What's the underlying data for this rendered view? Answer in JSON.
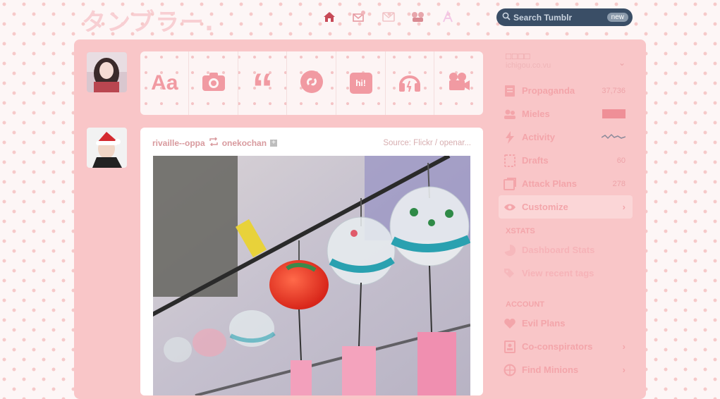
{
  "header": {
    "logo_text": "タンブラー.",
    "search": {
      "placeholder": "Search Tumblr",
      "badge": "new"
    },
    "nav_icons": [
      "home-icon",
      "inbox-icon",
      "mail-icon",
      "activity-icon",
      "account-icon"
    ]
  },
  "composer": {
    "buttons": [
      {
        "name": "text",
        "label": "Aa"
      },
      {
        "name": "photo",
        "label": ""
      },
      {
        "name": "quote",
        "label": "“"
      },
      {
        "name": "link",
        "label": ""
      },
      {
        "name": "chat",
        "label": "hi!"
      },
      {
        "name": "audio",
        "label": ""
      },
      {
        "name": "video",
        "label": ""
      }
    ]
  },
  "post": {
    "username": "rivaille--oppa",
    "reblogged_from": "onekochan",
    "source": "Source: Flickr / openar..."
  },
  "sidebar": {
    "blog_title": "□□□□",
    "blog_url": "ichigou.co.vu",
    "items": [
      {
        "label": "Propaganda",
        "count": "37,736",
        "icon": "posts-icon"
      },
      {
        "label": "Mieles",
        "count": "",
        "icon": "followers-icon"
      },
      {
        "label": "Activity",
        "count": "",
        "icon": "activity-icon"
      },
      {
        "label": "Drafts",
        "count": "60",
        "icon": "drafts-icon"
      },
      {
        "label": "Attack Plans",
        "count": "278",
        "icon": "queue-icon"
      },
      {
        "label": "Customize",
        "count": "",
        "icon": "eye-icon"
      }
    ],
    "xstats_title": "XSTATS",
    "xstats": [
      {
        "label": "Dashboard Stats",
        "icon": "stats-icon"
      },
      {
        "label": "View recent tags",
        "icon": "tags-icon"
      }
    ],
    "account_title": "ACCOUNT",
    "account": [
      {
        "label": "Evil Plans",
        "icon": "heart-icon"
      },
      {
        "label": "Co-conspirators",
        "icon": "people-icon"
      },
      {
        "label": "Find Minions",
        "icon": "compass-icon"
      }
    ]
  },
  "colors": {
    "accent": "#f3a5aa",
    "panel": "#f9c6c8",
    "search_bg": "#3a4e66"
  }
}
